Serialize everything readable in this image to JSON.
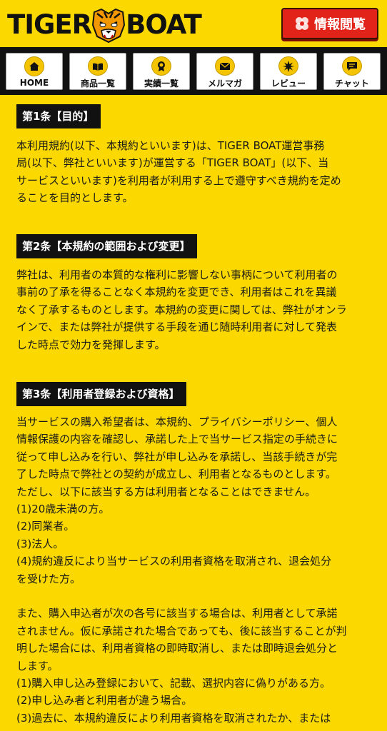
{
  "header": {
    "logo_left": "TIGER",
    "logo_right": "BOAT",
    "info_button_label": "情報閲覧"
  },
  "nav": {
    "items": [
      {
        "label": "HOME",
        "icon": "home-icon"
      },
      {
        "label": "商品一覧",
        "icon": "book-icon"
      },
      {
        "label": "実績一覧",
        "icon": "award-icon"
      },
      {
        "label": "メルマガ",
        "icon": "mail-icon"
      },
      {
        "label": "レビュー",
        "icon": "star-burst-icon"
      },
      {
        "label": "チャット",
        "icon": "chat-icon"
      }
    ]
  },
  "sections": [
    {
      "title": "第1条【目的】",
      "lines": [
        "本利用規約(以下、本規約といいます)は、TIGER BOAT運営事務",
        "局(以下、弊社といいます)が運営する「TIGER BOAT」(以下、当",
        "サービスといいます)を利用者が利用する上で遵守すべき規約を定め",
        "ることを目的とします。"
      ]
    },
    {
      "title": "第2条【本規約の範囲および変更】",
      "lines": [
        "弊社は、利用者の本質的な権利に影響しない事柄について利用者の",
        "事前の了承を得ることなく本規約を変更でき、利用者はこれを異議",
        "なく了承するものとします。本規約の変更に関しては、弊社がオンラ",
        "インで、または弊社が提供する手段を通じ随時利用者に対して発表",
        "した時点で効力を発揮します。"
      ]
    },
    {
      "title": "第3条【利用者登録および資格】",
      "lines": [
        "当サービスの購入希望者は、本規約、プライバシーポリシー、個人",
        "情報保護の内容を確認し、承諾した上で当サービス指定の手続きに",
        "従って申し込みを行い、弊社が申し込みを承諾し、当該手続きが完",
        "了した時点で弊社との契約が成立し、利用者となるものとします。",
        "ただし、以下に該当する方は利用者となることはできません。",
        "(1)20歳未満の方。",
        "(2)同業者。",
        "(3)法人。",
        "(4)規約違反により当サービスの利用者資格を取消され、退会処分",
        "を受けた方。",
        "",
        "また、購入申込者が次の各号に該当する場合は、利用者として承諾",
        "されません。仮に承諾された場合であっても、後に該当することが判",
        "明した場合には、利用者資格の即時取消し、または即時退会処分と",
        "します。",
        "(1)購入申し込み登録において、記載、選択内容に偽りがある方。",
        "(2)申し込み者と利用者が違う場合。",
        "(3)過去に、本規約違反により利用者資格を取消されたか、または"
      ]
    }
  ]
}
